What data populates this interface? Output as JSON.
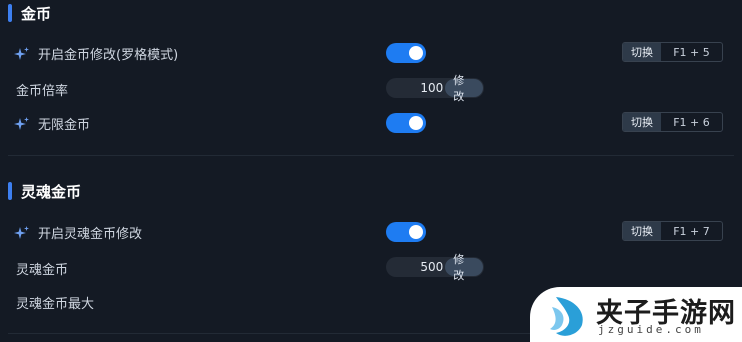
{
  "sections": [
    {
      "title": "金币",
      "rows": [
        {
          "type": "toggle",
          "label": "开启金币修改(罗格模式)",
          "icon": "sparkle-icon",
          "on": true,
          "hotkey": {
            "switch_label": "切换",
            "keys": "F1 + 5"
          }
        },
        {
          "type": "stepper",
          "label": "金币倍率",
          "value": "100",
          "button_label": "修改"
        },
        {
          "type": "toggle",
          "label": "无限金币",
          "icon": "sparkle-icon",
          "on": true,
          "hotkey": {
            "switch_label": "切换",
            "keys": "F1 + 6"
          }
        }
      ]
    },
    {
      "title": "灵魂金币",
      "rows": [
        {
          "type": "toggle",
          "label": "开启灵魂金币修改",
          "icon": "sparkle-icon",
          "on": true,
          "hotkey": {
            "switch_label": "切换",
            "keys": "F1 + 7"
          }
        },
        {
          "type": "stepper",
          "label": "灵魂金币",
          "value": "500",
          "button_label": "修改"
        },
        {
          "type": "label",
          "label": "灵魂金币最大"
        }
      ]
    }
  ],
  "watermark": {
    "title": "夹子手游网",
    "subtitle": "jzguide.com",
    "brand_color": "#2a9fd8"
  },
  "colors": {
    "background": "#141a24",
    "accent": "#1e7cf2",
    "section_bar": "#3d7ff0"
  }
}
